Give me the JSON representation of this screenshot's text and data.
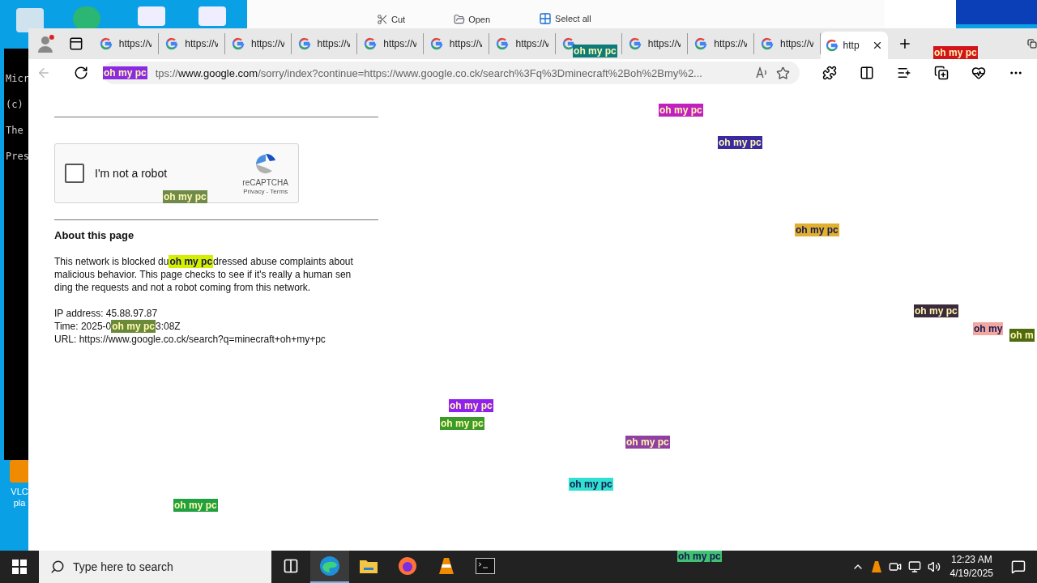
{
  "desktop": {
    "icon_label_lines": [
      "VLC",
      "pla"
    ]
  },
  "explorer": {
    "ribbon": [
      {
        "label": "Cut",
        "kind": "cut"
      },
      {
        "label": "Open",
        "kind": "open"
      },
      {
        "label": "Select all",
        "kind": "select"
      }
    ]
  },
  "console": {
    "lines": [
      "Micr",
      "(c)",
      "The",
      "Pres"
    ]
  },
  "browser": {
    "tabs": [
      {
        "label": "https://v",
        "selected": false
      },
      {
        "label": "https://v",
        "selected": false
      },
      {
        "label": "https://v",
        "selected": false
      },
      {
        "label": "https://v",
        "selected": false
      },
      {
        "label": "https://v",
        "selected": false
      },
      {
        "label": "https://v",
        "selected": false
      },
      {
        "label": "https://v",
        "selected": false
      },
      {
        "selected": false,
        "overlay": {
          "text": "oh my pc",
          "color": "#0e7a7a"
        }
      },
      {
        "label": "https://v",
        "selected": false
      },
      {
        "label": "https://v",
        "selected": false
      },
      {
        "label": "https://v",
        "selected": false
      },
      {
        "label": "http",
        "selected": true
      }
    ],
    "window_overlay": {
      "text": "oh my pc",
      "color": "#d4141c"
    },
    "address": {
      "overlay": {
        "text": "oh my pc",
        "color": "#8a2be2"
      },
      "prefix": "tps://",
      "host": "www.google.com",
      "rest": "/sorry/index?continue=https://www.google.co.ck/search%3Fq%3Dminecraft%2Boh%2Bmy%2..."
    }
  },
  "page": {
    "captcha": {
      "label": "I'm not a robot",
      "checked": false,
      "brand": "reCAPTCHA",
      "links": "Privacy - Terms",
      "overlay": {
        "text": "oh my pc",
        "color": "#6f8a4a"
      }
    },
    "heading": "About this page",
    "paragraph": {
      "before": "This network is blocked du",
      "overlay": {
        "text": "oh my pc",
        "color": "#d4f000"
      },
      "after": "dressed abuse complaints about",
      "lines": [
        "malicious behavior. This page checks to see if it's really a human sen",
        "ding the requests and not a robot coming from this network."
      ]
    },
    "ip": "IP address: 45.88.97.87",
    "time": {
      "before": "Time: 2025-0",
      "overlay": {
        "text": "oh my pc",
        "color": "#6a8a3a"
      },
      "after": "3:08Z"
    },
    "url": "URL: https://www.google.co.ck/search?q=minecraft+oh+my+pc",
    "overlays": [
      {
        "text": "oh my pc",
        "color": "#c020c0"
      },
      {
        "text": "oh my pc",
        "color": "#3a2aa0"
      },
      {
        "text": "oh my pc",
        "color": "#e0b030"
      },
      {
        "text": "oh my pc",
        "color": "#3a2a3a"
      },
      {
        "text": "oh my",
        "color": "#f0a8a0"
      },
      {
        "text": "oh m",
        "color": "#506a10"
      },
      {
        "text": "oh my pc",
        "color": "#9020f0"
      },
      {
        "text": "oh my pc",
        "color": "#3a9a2a"
      },
      {
        "text": "oh my pc",
        "color": "#9040a0"
      },
      {
        "text": "oh my pc",
        "color": "#30e0d0"
      },
      {
        "text": "oh my pc",
        "color": "#20a040"
      }
    ]
  },
  "taskbar": {
    "search_placeholder": "Type here to search",
    "apps": [
      {
        "kind": "taskview",
        "selected": false
      },
      {
        "kind": "edge",
        "selected": true
      },
      {
        "kind": "explorer",
        "selected": false
      },
      {
        "kind": "firefox",
        "selected": false
      },
      {
        "kind": "vlc",
        "selected": false
      },
      {
        "kind": "terminal",
        "selected": false
      }
    ],
    "overlay": {
      "text": "oh my pc",
      "color": "#40c070"
    },
    "time": "12:23 AM",
    "date": "4/19/2025"
  }
}
